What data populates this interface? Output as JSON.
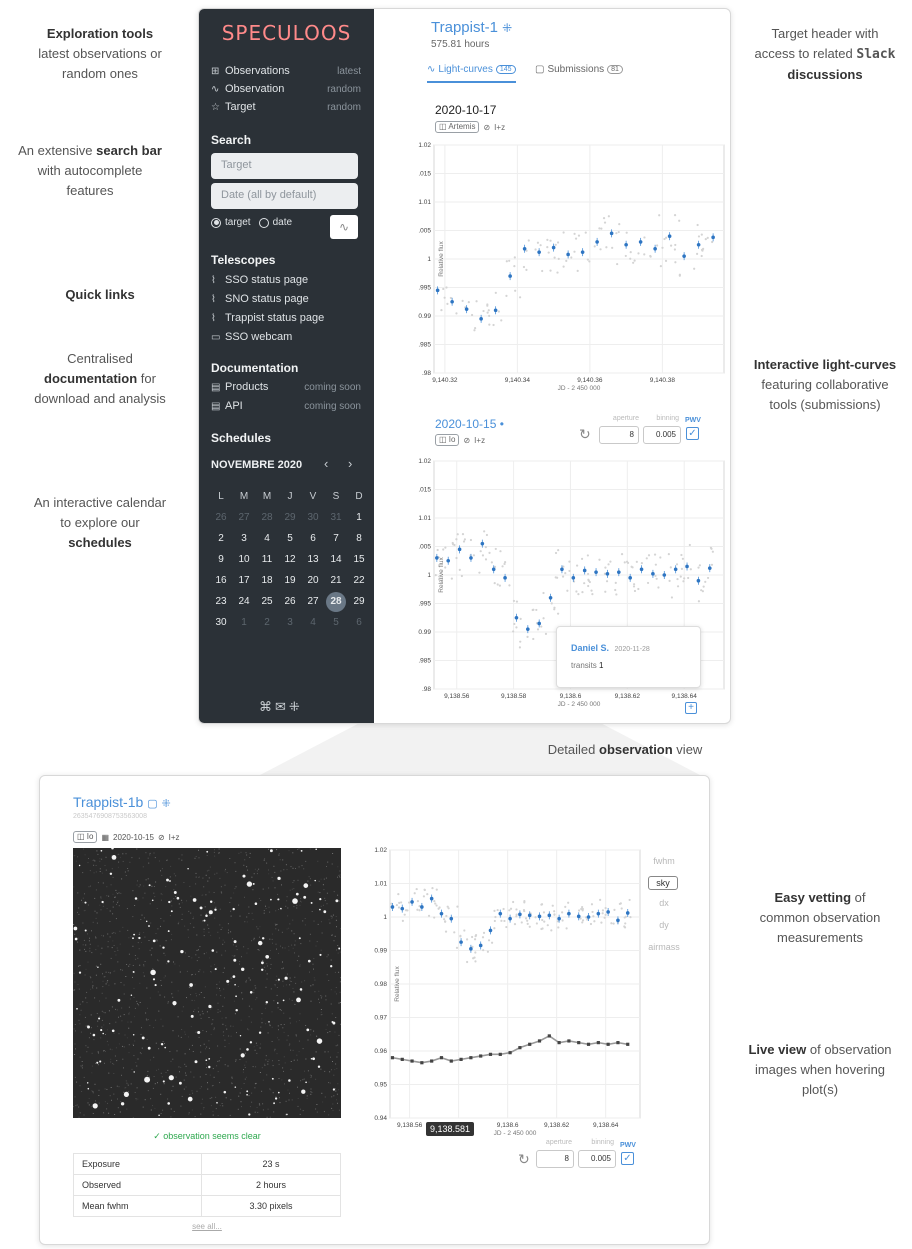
{
  "annotations": {
    "left": [
      {
        "html": "<b>Exploration tools</b><br>latest observations or<br>random ones"
      },
      {
        "html": "An extensive <b>search bar</b><br>with autocomplete<br>features"
      },
      {
        "html": "<b>Quick links</b>"
      },
      {
        "html": "Centralised<br><b>documentation</b> for<br>download and analysis"
      },
      {
        "html": "An interactive calendar<br>to explore our<br><b>schedules</b>"
      }
    ],
    "right": [
      {
        "html": "Target header with<br>access to related <span class=\"mono\">Slack</span><br><b>discussions</b>"
      },
      {
        "html": "<b>Interactive light-curves</b><br>featuring collaborative<br>tools (submissions)"
      },
      {
        "html": "<b>Easy vetting</b> of<br>common observation<br>measurements"
      },
      {
        "html": "<b>Live view</b> of observation<br>images when hovering<br>plot(s)"
      }
    ],
    "middle": "Detailed <b>observation</b> view"
  },
  "sidebar": {
    "logo": "SPECULOOS",
    "explore": [
      {
        "icon": "grid-icon",
        "glyph": "⊞",
        "label": "Observations",
        "right": "latest"
      },
      {
        "icon": "pulse-icon",
        "glyph": "∿",
        "label": "Observation",
        "right": "random"
      },
      {
        "icon": "star-icon",
        "glyph": "☆",
        "label": "Target",
        "right": "random"
      }
    ],
    "search_title": "Search",
    "target_placeholder": "Target",
    "date_placeholder": "Date (all by default)",
    "radio_target": "target",
    "radio_date": "date",
    "telescopes_title": "Telescopes",
    "telescopes": [
      {
        "icon": "rss-icon",
        "glyph": "⌇",
        "label": "SSO status page"
      },
      {
        "icon": "rss-icon",
        "glyph": "⌇",
        "label": "SNO status page"
      },
      {
        "icon": "rss-icon",
        "glyph": "⌇",
        "label": "Trappist status page"
      },
      {
        "icon": "video-icon",
        "glyph": "▭",
        "label": "SSO webcam"
      }
    ],
    "documentation_title": "Documentation",
    "documentation": [
      {
        "icon": "file-icon",
        "glyph": "▤",
        "label": "Products",
        "right": "coming soon"
      },
      {
        "icon": "file-icon",
        "glyph": "▤",
        "label": "API",
        "right": "coming soon"
      }
    ],
    "schedules_title": "Schedules",
    "calendar_month": "NOVEMBRE 2020",
    "calendar_weekdays": [
      "L",
      "M",
      "M",
      "J",
      "V",
      "S",
      "D"
    ],
    "calendar_days": [
      [
        "26",
        "27",
        "28",
        "29",
        "30",
        "31",
        "1"
      ],
      [
        "2",
        "3",
        "4",
        "5",
        "6",
        "7",
        "8"
      ],
      [
        "9",
        "10",
        "11",
        "12",
        "13",
        "14",
        "15"
      ],
      [
        "16",
        "17",
        "18",
        "19",
        "20",
        "21",
        "22"
      ],
      [
        "23",
        "24",
        "25",
        "26",
        "27",
        "28",
        "29"
      ],
      [
        "30",
        "1",
        "2",
        "3",
        "4",
        "5",
        "6"
      ]
    ],
    "selected_day": "28"
  },
  "header": {
    "target": "Trappist-1",
    "hours": "575.81 hours",
    "tab_lightcurves": "Light-curves",
    "tab_lightcurves_count": "145",
    "tab_submissions": "Submissions",
    "tab_submissions_count": "81"
  },
  "chart1": {
    "date": "2020-10-17",
    "telescope": "Artemis",
    "filter": "I+z"
  },
  "chart2": {
    "date": "2020-10-15 •",
    "telescope": "Io",
    "filter": "I+z",
    "aperture_label": "aperture",
    "aperture_value": "8",
    "binning_label": "binning",
    "binning_value": "0.005",
    "pwv_label": "PWV",
    "tooltip_name": "Daniel S.",
    "tooltip_date": "2020-11-28",
    "tooltip_key": "transits",
    "tooltip_value": "1"
  },
  "bottom": {
    "target": "Trappist-1b",
    "id": "2635476908753563008",
    "telescope": "Io",
    "date": "2020-10-15",
    "filter": "I+z",
    "clear_text": "observation seems clear",
    "table": [
      {
        "key": "Exposure",
        "value": "23 s"
      },
      {
        "key": "Observed",
        "value": "2 hours"
      },
      {
        "key": "Mean fwhm",
        "value": "3.30 pixels"
      }
    ],
    "see_all": "see all...",
    "measurements": [
      "fwhm",
      "sky",
      "dx",
      "dy",
      "airmass"
    ],
    "selected_measurement": "sky",
    "hover_x": "9,138.581",
    "aperture_label": "aperture",
    "aperture_value": "8",
    "binning_label": "binning",
    "binning_value": "0.005",
    "pwv_label": "PWV"
  },
  "chart_data": [
    {
      "type": "scatter",
      "title": "2020-10-17",
      "xlabel": "JD - 2 450 000",
      "ylabel": "Relative flux",
      "xlim": [
        9140.317,
        9140.397
      ],
      "ylim": [
        0.98,
        1.02
      ],
      "x_ticks": [
        "9,140.32",
        "9,140.34",
        "9,140.36",
        "9,140.38"
      ],
      "y_ticks": [
        ".98",
        ".985",
        "0.99",
        ".995",
        "1",
        ".005",
        "1.01",
        ".015",
        "1.02"
      ],
      "series": [
        {
          "x": [
            9140.318,
            9140.322,
            9140.326,
            9140.33,
            9140.334,
            9140.338,
            9140.342,
            9140.346,
            9140.35,
            9140.354,
            9140.358,
            9140.362,
            9140.366,
            9140.37,
            9140.374,
            9140.378,
            9140.382,
            9140.386,
            9140.39,
            9140.394
          ],
          "y": [
            0.9945,
            0.9925,
            0.9912,
            0.9895,
            0.991,
            0.997,
            1.0018,
            1.0012,
            1.002,
            1.0008,
            1.0012,
            1.003,
            1.0045,
            1.0025,
            1.003,
            1.0018,
            1.004,
            1.0005,
            1.0025,
            1.0038
          ]
        }
      ]
    },
    {
      "type": "scatter",
      "title": "2020-10-15 •",
      "xlabel": "JD - 2 450 000",
      "ylabel": "Relative flux",
      "xlim": [
        9138.552,
        9138.654
      ],
      "ylim": [
        0.98,
        1.02
      ],
      "x_ticks": [
        "9,138.56",
        "9,138.58",
        "9,138.6",
        "9,138.62",
        "9,138.64"
      ],
      "y_ticks": [
        ".98",
        ".985",
        "0.99",
        ".995",
        "1",
        ".005",
        "1.01",
        ".015",
        "1.02"
      ],
      "series": [
        {
          "x": [
            9138.553,
            9138.557,
            9138.561,
            9138.565,
            9138.569,
            9138.573,
            9138.577,
            9138.581,
            9138.585,
            9138.589,
            9138.593,
            9138.597,
            9138.601,
            9138.605,
            9138.609,
            9138.613,
            9138.617,
            9138.621,
            9138.625,
            9138.629,
            9138.633,
            9138.637,
            9138.641,
            9138.645,
            9138.649
          ],
          "y": [
            1.003,
            1.0025,
            1.0045,
            1.003,
            1.0055,
            1.001,
            0.9995,
            0.9925,
            0.9905,
            0.9915,
            0.996,
            1.001,
            0.9995,
            1.0008,
            1.0005,
            1.0002,
            1.0005,
            0.9995,
            1.001,
            1.0002,
            1.0,
            1.001,
            1.0015,
            0.999,
            1.0012
          ]
        }
      ]
    },
    {
      "type": "line",
      "xlabel": "JD - 2 450 000",
      "ylabel": "Relative flux",
      "xlim": [
        9138.552,
        9138.654
      ],
      "ylim": [
        0.94,
        1.02
      ],
      "x_ticks": [
        "9,138.56",
        "9,138.58",
        "9,138.6",
        "9,138.62",
        "9,138.64"
      ],
      "y_ticks": [
        "0.94",
        "0.95",
        "0.96",
        "0.97",
        "0.98",
        "0.99",
        "1",
        "1.01",
        "1.02"
      ],
      "series": [
        {
          "name": "flux",
          "x": [
            9138.553,
            9138.557,
            9138.561,
            9138.565,
            9138.569,
            9138.573,
            9138.577,
            9138.581,
            9138.585,
            9138.589,
            9138.593,
            9138.597,
            9138.601,
            9138.605,
            9138.609,
            9138.613,
            9138.617,
            9138.621,
            9138.625,
            9138.629,
            9138.633,
            9138.637,
            9138.641,
            9138.645,
            9138.649
          ],
          "y": [
            1.003,
            1.0025,
            1.0045,
            1.003,
            1.0055,
            1.001,
            0.9995,
            0.9925,
            0.9905,
            0.9915,
            0.996,
            1.001,
            0.9995,
            1.0008,
            1.0005,
            1.0002,
            1.0005,
            0.9995,
            1.001,
            1.0002,
            1.0,
            1.001,
            1.0015,
            0.999,
            1.0012
          ]
        },
        {
          "name": "sky",
          "x": [
            9138.553,
            9138.557,
            9138.561,
            9138.565,
            9138.569,
            9138.573,
            9138.577,
            9138.581,
            9138.585,
            9138.589,
            9138.593,
            9138.597,
            9138.601,
            9138.605,
            9138.609,
            9138.613,
            9138.617,
            9138.621,
            9138.625,
            9138.629,
            9138.633,
            9138.637,
            9138.641,
            9138.645,
            9138.649
          ],
          "y": [
            0.958,
            0.9575,
            0.957,
            0.9565,
            0.957,
            0.958,
            0.957,
            0.9575,
            0.958,
            0.9585,
            0.959,
            0.959,
            0.9595,
            0.961,
            0.962,
            0.963,
            0.9645,
            0.9625,
            0.963,
            0.9625,
            0.962,
            0.9625,
            0.962,
            0.9625,
            0.962
          ]
        }
      ]
    }
  ]
}
